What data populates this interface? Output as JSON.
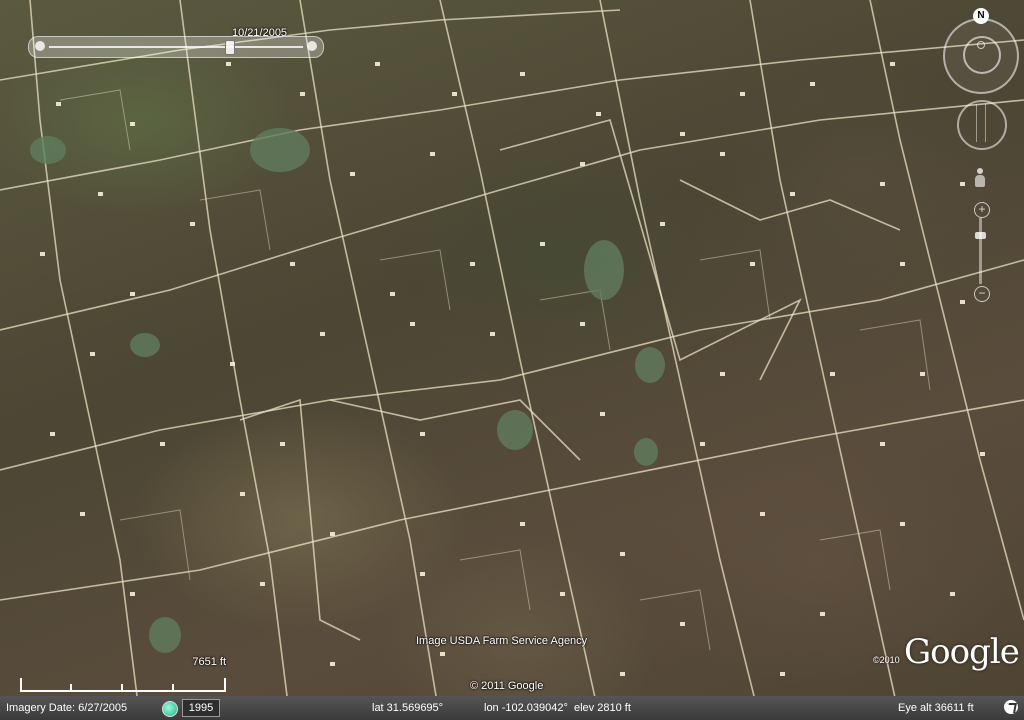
{
  "window": {
    "slider_date": "10/21/2005",
    "north_label": "N"
  },
  "map": {
    "image_credit": "Image USDA Farm Service Agency",
    "copyright": "© 2011 Google",
    "logo_text": "Google",
    "logo_year": "©2010",
    "scale_label": "7651 ft"
  },
  "status_bar": {
    "imagery_date": "Imagery Date: 6/27/2005",
    "history_year": "1995",
    "lat": "lat   31.569695°",
    "lon": "lon -102.039042°",
    "elev": "elev  2810 ft",
    "eye_alt": "Eye alt   36611 ft"
  },
  "icons": [
    "history-clock-icon",
    "compass-north-icon",
    "look-joystick-icon",
    "move-joystick-icon",
    "street-view-person-icon",
    "zoom-plus-icon",
    "zoom-minus-icon",
    "streaming-status-icon"
  ]
}
